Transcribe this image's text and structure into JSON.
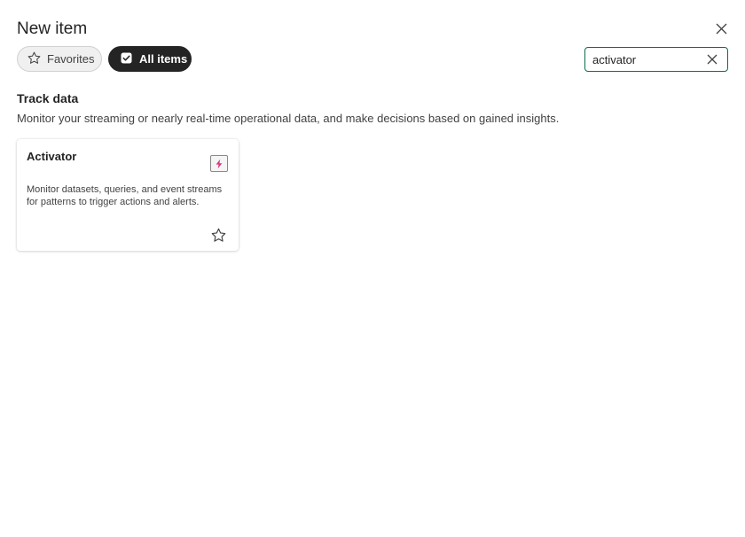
{
  "dialog": {
    "title": "New item",
    "close_icon": "close-icon"
  },
  "filters": {
    "favorites_label": "Favorites",
    "favorites_icon": "star-outline-icon",
    "all_items_label": "All items",
    "all_items_icon": "checkbox-checked-icon",
    "active": "All items"
  },
  "search": {
    "value": "activator",
    "clear_icon": "clear-icon"
  },
  "section": {
    "title": "Track data",
    "description": "Monitor your streaming or nearly real-time operational data, and make decisions based on gained insights."
  },
  "cards": [
    {
      "title": "Activator",
      "description": "Monitor datasets, queries, and event streams for patterns to trigger actions and alerts.",
      "icon": "activator-lightning-icon",
      "favorite_icon": "star-outline-icon"
    }
  ],
  "colors": {
    "accent": "#0f6b4f",
    "active_pill": "#242424",
    "activator_icon": "#d6337f"
  }
}
